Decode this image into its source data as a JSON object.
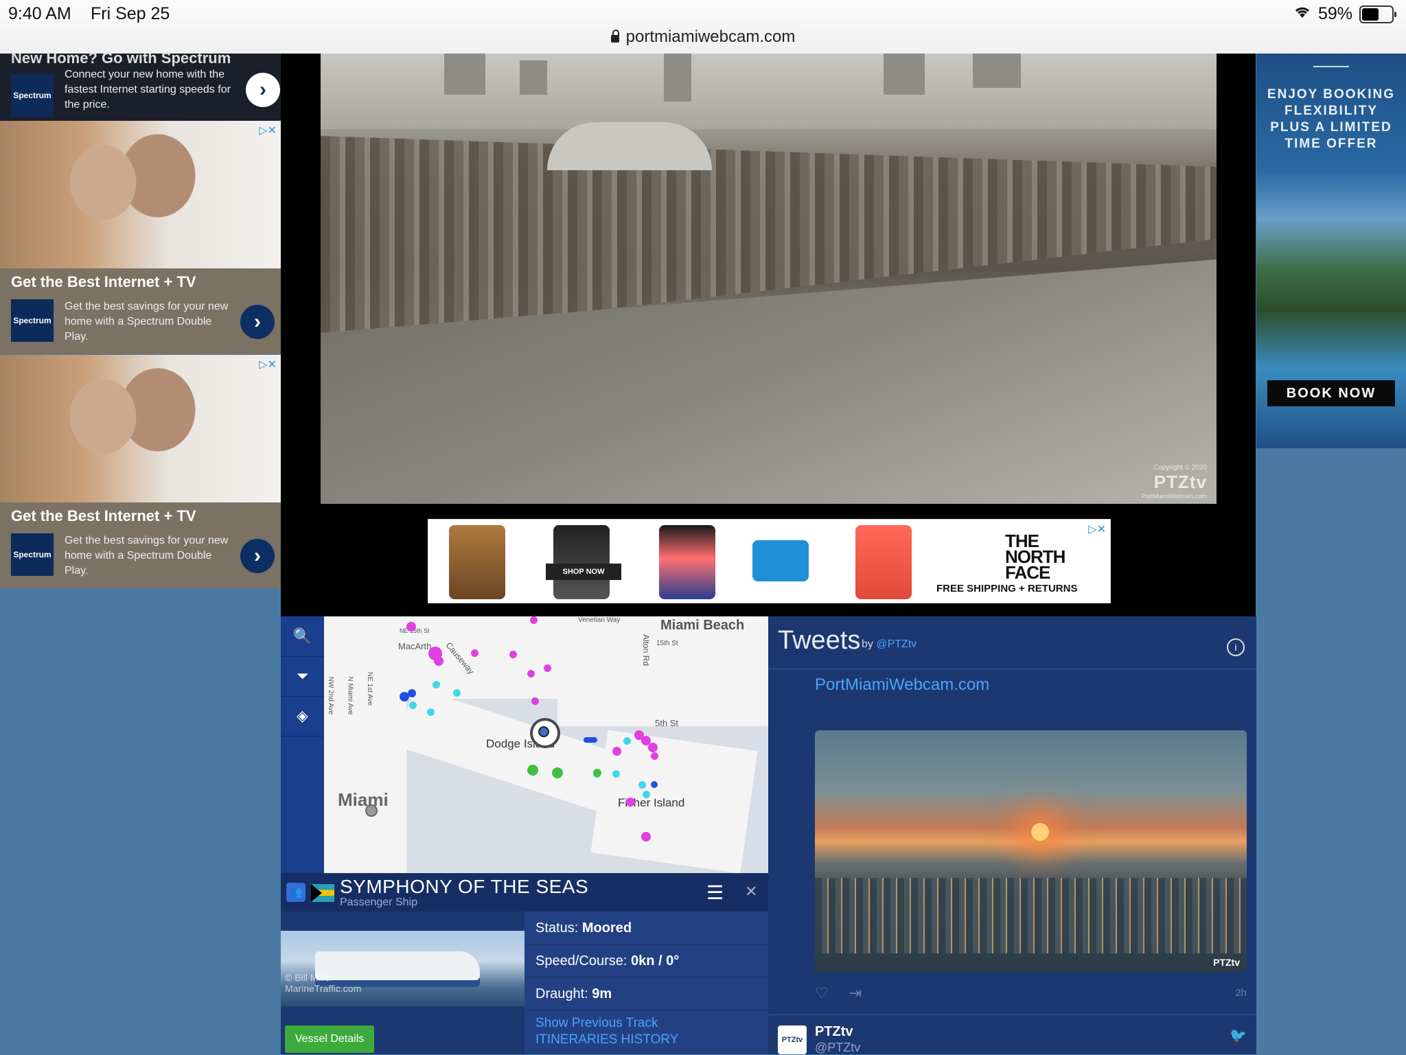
{
  "status_bar": {
    "time": "9:40 AM",
    "date": "Fri Sep 25",
    "battery": "59%",
    "battery_level": 0.59
  },
  "browser": {
    "url": "portmiamiwebcam.com"
  },
  "left_ads": {
    "top_ad": {
      "clipped_title": "New Home? Go with Spectrum",
      "logo": "Spectrum",
      "text": "Connect your new home with the fastest Internet starting speeds for the price."
    },
    "cards": [
      {
        "headline": "Get the Best Internet + TV",
        "logo": "Spectrum",
        "text": "Get the best savings for your new home with a Spectrum Double Play."
      },
      {
        "headline": "Get the Best Internet + TV",
        "logo": "Spectrum",
        "text": "Get the best savings for your new home with a Spectrum Double Play."
      }
    ]
  },
  "webcam": {
    "copyright": "Copyright © 2020",
    "brand": "PTZtv",
    "site": "PortMiamiWebcam.com"
  },
  "northface_ad": {
    "shop_now": "SHOP NOW",
    "logo_line1": "THE",
    "logo_line2": "NORTH",
    "logo_line3": "FACE",
    "shipping": "FREE SHIPPING + RETURNS"
  },
  "right_ad": {
    "headline_1": "ENJOY BOOKING",
    "headline_2": "FLEXIBILITY",
    "headline_3": "PLUS A LIMITED",
    "headline_4": "TIME OFFER",
    "button": "BOOK NOW"
  },
  "map": {
    "labels": {
      "miami_beach": "Miami Beach",
      "dodge_island": "Dodge Island",
      "miami": "Miami",
      "fisher_island": "Fisher Island",
      "fifth_st": "5th St",
      "fifteenth_st": "15th St",
      "alton_rd": "Alton Rd",
      "causeway": "Causeway",
      "venetian_way": "Venetian Way",
      "macarthur": "MacArth",
      "ne_15th_st": "NE 15th St",
      "nw_2nd_ave": "NW 2nd Ave",
      "n_miami_ave": "N Miami Ave",
      "ne_1st_ave": "NE 1st Ave"
    },
    "colors": {
      "passenger": "#e040e0",
      "tug": "#40d8e8",
      "cargo": "#40c040",
      "other": "#2050e0"
    }
  },
  "vessel": {
    "name": "SYMPHONY OF THE SEAS",
    "type": "Passenger Ship",
    "photo_credit_1": "© Bill Miller",
    "photo_credit_2": "MarineTraffic.com",
    "status_label": "Status:",
    "status_value": "Moored",
    "speed_label": "Speed/Course:",
    "speed_value": "0kn / 0°",
    "draught_label": "Draught:",
    "draught_value": "9m",
    "show_track": "Show Previous Track",
    "itineraries": "ITINERARIES HISTORY",
    "details_button": "Vessel Details"
  },
  "tweets": {
    "title": "Tweets",
    "by": "by",
    "handle": "@PTZtv",
    "link": "PortMiamiWebcam.com",
    "image_watermark": "PTZtv",
    "time_ago": "2h",
    "next_author": "PTZtv",
    "next_handle": "@PTZtv",
    "avatar_text": "PTZtv"
  }
}
